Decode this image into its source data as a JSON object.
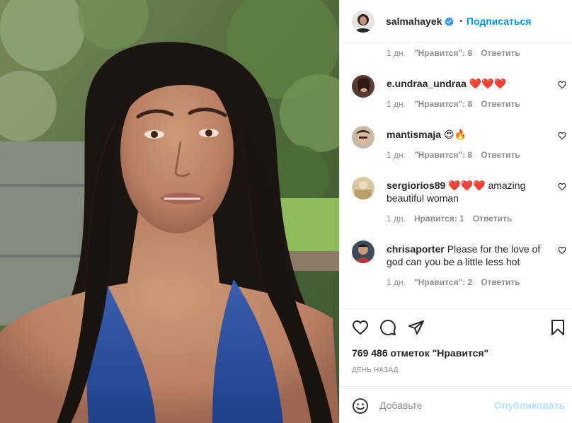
{
  "post": {
    "author": "salmahayek",
    "verified": true,
    "separator": "•",
    "follow_label": "Подписаться",
    "photo_alt_icon": "selfie-photo"
  },
  "comments": [
    {
      "user": "",
      "text": "",
      "time": "1 дн.",
      "likes": "\"Нравится\": 8",
      "reply": "Ответить"
    },
    {
      "user": "e.undraa_undraa",
      "text": "❤️❤️❤️",
      "time": "1 дн.",
      "likes": "\"Нравится\": 8",
      "reply": "Ответить"
    },
    {
      "user": "mantismaja",
      "text": "😍🔥",
      "time": "1 дн.",
      "likes": "\"Нравится\": 8",
      "reply": "Ответить"
    },
    {
      "user": "sergiorios89",
      "text": "❤️❤️❤️ amazing beautiful woman",
      "time": "1 дн.",
      "likes": "Нравится: 1",
      "reply": "Ответить"
    },
    {
      "user": "chrisaporter",
      "text": "Please for the love of god can you be a little less hot",
      "time": "1 дн.",
      "likes": "\"Нравится\": 2",
      "reply": "Ответить"
    }
  ],
  "actions": {
    "like_icon": "heart-icon",
    "comment_icon": "comment-icon",
    "share_icon": "share-icon",
    "save_icon": "bookmark-icon"
  },
  "likes_count": "769 486 отметок \"Нравится\"",
  "post_date": "ДЕНЬ НАЗАД",
  "add_comment": {
    "emoji_icon": "smiley-icon",
    "placeholder": "Добавьте",
    "publish_label": "Опубликовать"
  },
  "colors": {
    "link_blue": "#0095f6",
    "publish_disabled": "#b2dffc",
    "muted": "#8e8e8e",
    "text": "#262626",
    "border": "#efefef"
  }
}
